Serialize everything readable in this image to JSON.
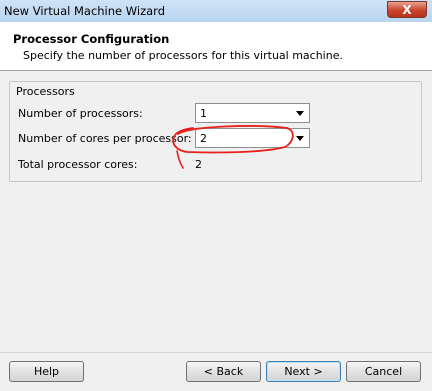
{
  "window": {
    "title": "New Virtual Machine Wizard",
    "close_symbol": "X"
  },
  "header": {
    "title": "Processor Configuration",
    "subtitle": "Specify the number of processors for this virtual machine."
  },
  "processors": {
    "group_label": "Processors",
    "num_processors_label": "Number of processors:",
    "num_processors_value": "1",
    "cores_label": "Number of cores per processor:",
    "cores_value": "2",
    "total_label": "Total processor cores:",
    "total_value": "2"
  },
  "footer": {
    "help": "Help",
    "back": "< Back",
    "next": "Next >",
    "cancel": "Cancel"
  },
  "colors": {
    "annotation": "#e8201c",
    "close_button": "#c8452c"
  }
}
